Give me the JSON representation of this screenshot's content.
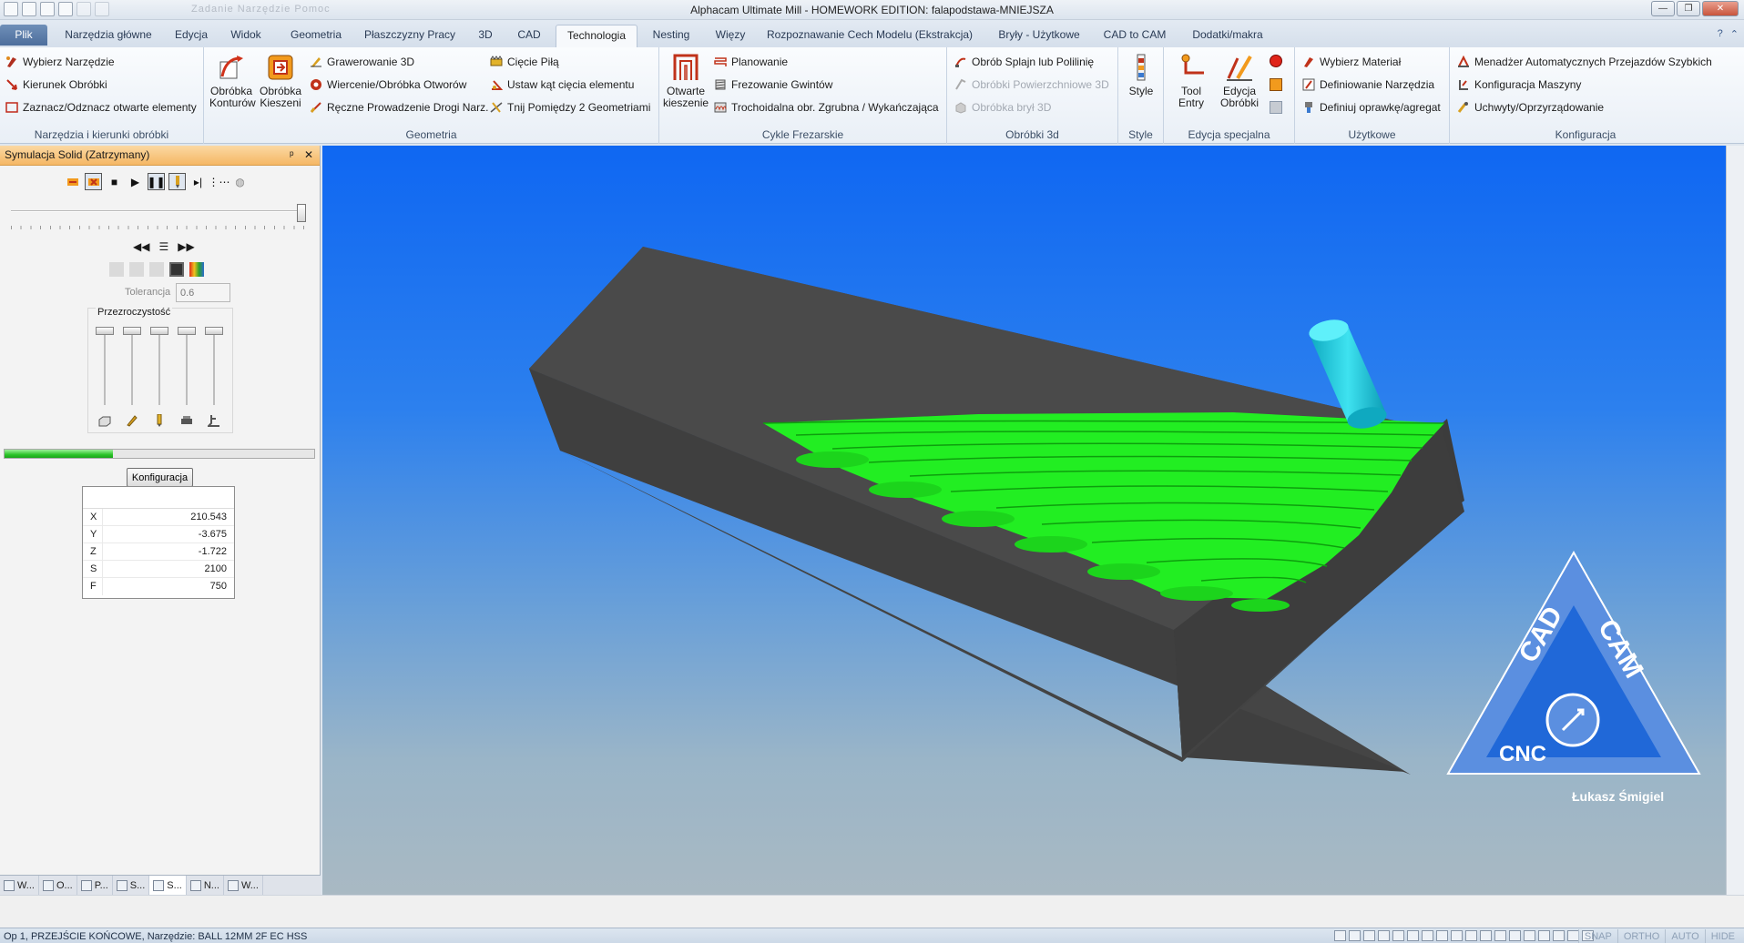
{
  "window": {
    "title": "Alphacam Ultimate Mill - HOMEWORK EDITION: falapodstawa-MNIEJSZA",
    "qat_menu": "Zadanie  Narzędzie  Pomoc",
    "min": "—",
    "max": "❐",
    "close": "✕"
  },
  "tabs": [
    {
      "label": "Plik"
    },
    {
      "label": "Narzędzia główne"
    },
    {
      "label": "Edycja"
    },
    {
      "label": "Widok"
    },
    {
      "label": "Geometria"
    },
    {
      "label": "Płaszczyzny Pracy"
    },
    {
      "label": "3D"
    },
    {
      "label": "CAD"
    },
    {
      "label": "Technologia"
    },
    {
      "label": "Nesting"
    },
    {
      "label": "Więzy"
    },
    {
      "label": "Rozpoznawanie Cech Modelu (Ekstrakcja)"
    },
    {
      "label": "Bryły - Użytkowe"
    },
    {
      "label": "CAD to CAM"
    },
    {
      "label": "Dodatki/makra"
    }
  ],
  "ribbon": {
    "g1": {
      "label": "Narzędzia i kierunki obróbki",
      "items": [
        "Wybierz Narzędzie",
        "Kierunek Obróbki",
        "Zaznacz/Odznacz otwarte elementy"
      ]
    },
    "g2": {
      "label": "Geometria",
      "big": [
        "Obróbka Konturów",
        "Obróbka Kieszeni"
      ],
      "col1": [
        "Grawerowanie 3D",
        "Wiercenie/Obróbka Otworów",
        "Ręczne Prowadzenie Drogi Narz."
      ],
      "col2": [
        "Cięcie Piłą",
        "Ustaw kąt cięcia elementu",
        "Tnij Pomiędzy 2 Geometriami"
      ]
    },
    "g3": {
      "label": "Cykle Frezarskie",
      "big": "Otwarte kieszenie",
      "items": [
        "Planowanie",
        "Frezowanie Gwintów",
        "Trochoidalna obr. Zgrubna / Wykańczająca"
      ]
    },
    "g4": {
      "label": "Obróbki 3d",
      "items": [
        "Obrób Splajn lub Polilinię",
        "Obróbki Powierzchniowe 3D",
        "Obróbka brył 3D"
      ]
    },
    "g5": {
      "label": "Style",
      "big": "Style"
    },
    "g6": {
      "label": "Edycja specjalna",
      "big": [
        "Tool Entry",
        "Edycja Obróbki"
      ]
    },
    "g7": {
      "label": "Użytkowe",
      "items": [
        "Wybierz Materiał",
        "Definiowanie Narzędzia",
        "Definiuj oprawkę/agregat"
      ]
    },
    "g8": {
      "label": "Konfiguracja",
      "items": [
        "Menadżer Automatycznych Przejazdów Szybkich",
        "Konfiguracja Maszyny",
        "Uchwyty/Oprzyrządowanie"
      ]
    }
  },
  "panel": {
    "title": "Symulacja Solid (Zatrzymany)",
    "pin": "ᵖ",
    "close": "✕",
    "tolerance_label": "Tolerancja",
    "tolerance_value": "0.6",
    "transparency_label": "Przezroczystość",
    "progress": 0.35,
    "config_button": "Konfiguracja",
    "coords": [
      {
        "k": "X",
        "v": "210.543"
      },
      {
        "k": "Y",
        "v": "-3.675"
      },
      {
        "k": "Z",
        "v": "-1.722"
      },
      {
        "k": "S",
        "v": "2100"
      },
      {
        "k": "F",
        "v": "750"
      }
    ],
    "bottom_tabs": [
      "W...",
      "O...",
      "P...",
      "S...",
      "S...",
      "N...",
      "W..."
    ]
  },
  "viewport": {
    "logo_top": "CAD",
    "logo_right": "CAM",
    "logo_bottom": "CNC",
    "author": "Łukasz Śmigiel"
  },
  "status": {
    "text": "Op 1, PRZEJŚCIE KOŃCOWE, Narzędzie: BALL 12MM 2F EC HSS",
    "modes": [
      "SNAP",
      "ORTHO",
      "AUTO",
      "HIDE"
    ]
  },
  "colors": {
    "accent_tab": "#4d6e9c",
    "panel_header": "#f5b765",
    "cut_green": "#22ee22",
    "tool_cyan": "#22c8dc",
    "stock": "#4a4a4a",
    "logo": "#5a8fe0"
  }
}
